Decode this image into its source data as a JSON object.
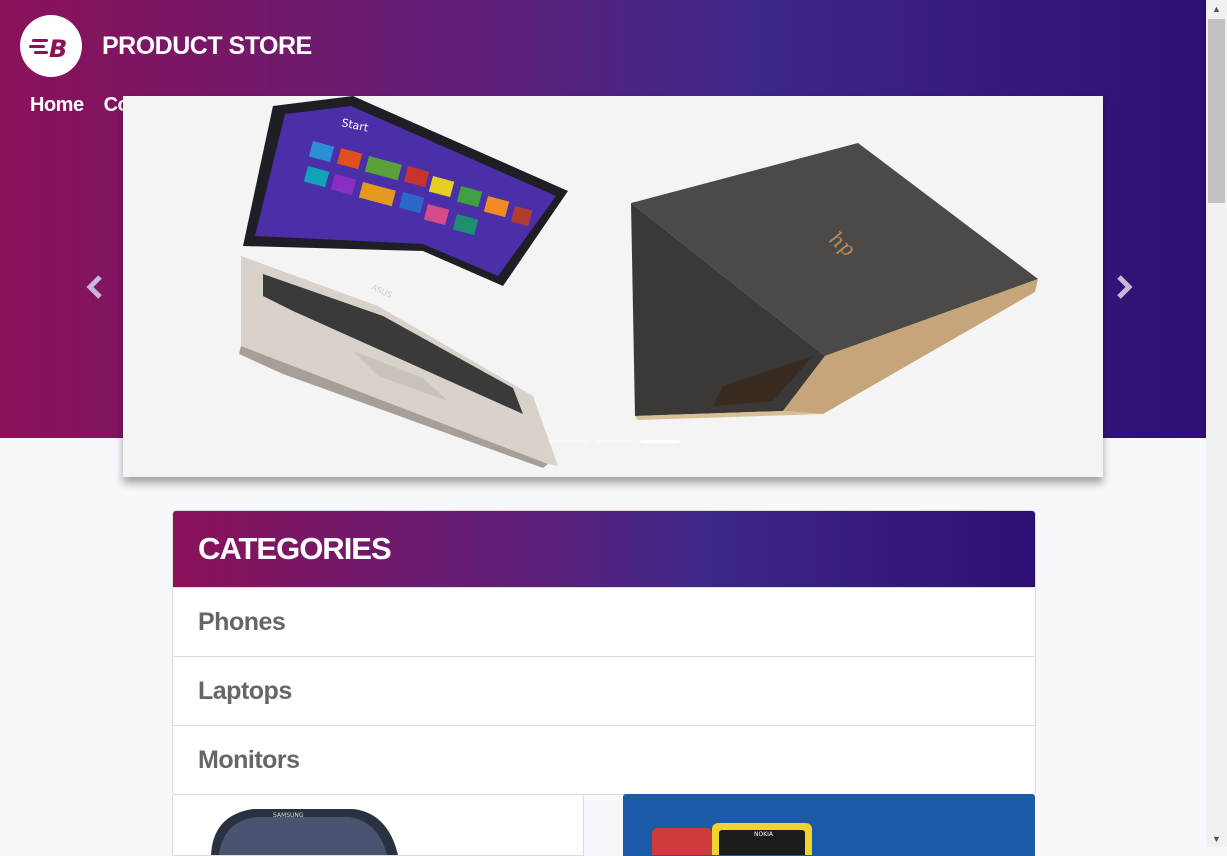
{
  "header": {
    "brand_name": "PRODUCT STORE",
    "logo_letter": "B",
    "nav": [
      "Home",
      "Co"
    ]
  },
  "carousel": {
    "slides": 3,
    "active_slide": 3,
    "laptop_left_brand": "ASUS",
    "start_label": "Start",
    "laptop_right_brand": "hp"
  },
  "categories": {
    "title": "CATEGORIES",
    "items": [
      "Phones",
      "Laptops",
      "Monitors"
    ]
  },
  "products": {
    "phone_brand": "SAMSUNG",
    "nokia_brand": "NOKIA"
  },
  "colors": {
    "gradient_start": "#8b1159",
    "gradient_end": "#2d0f73",
    "nokia_card_bg": "#1a5aa6"
  }
}
